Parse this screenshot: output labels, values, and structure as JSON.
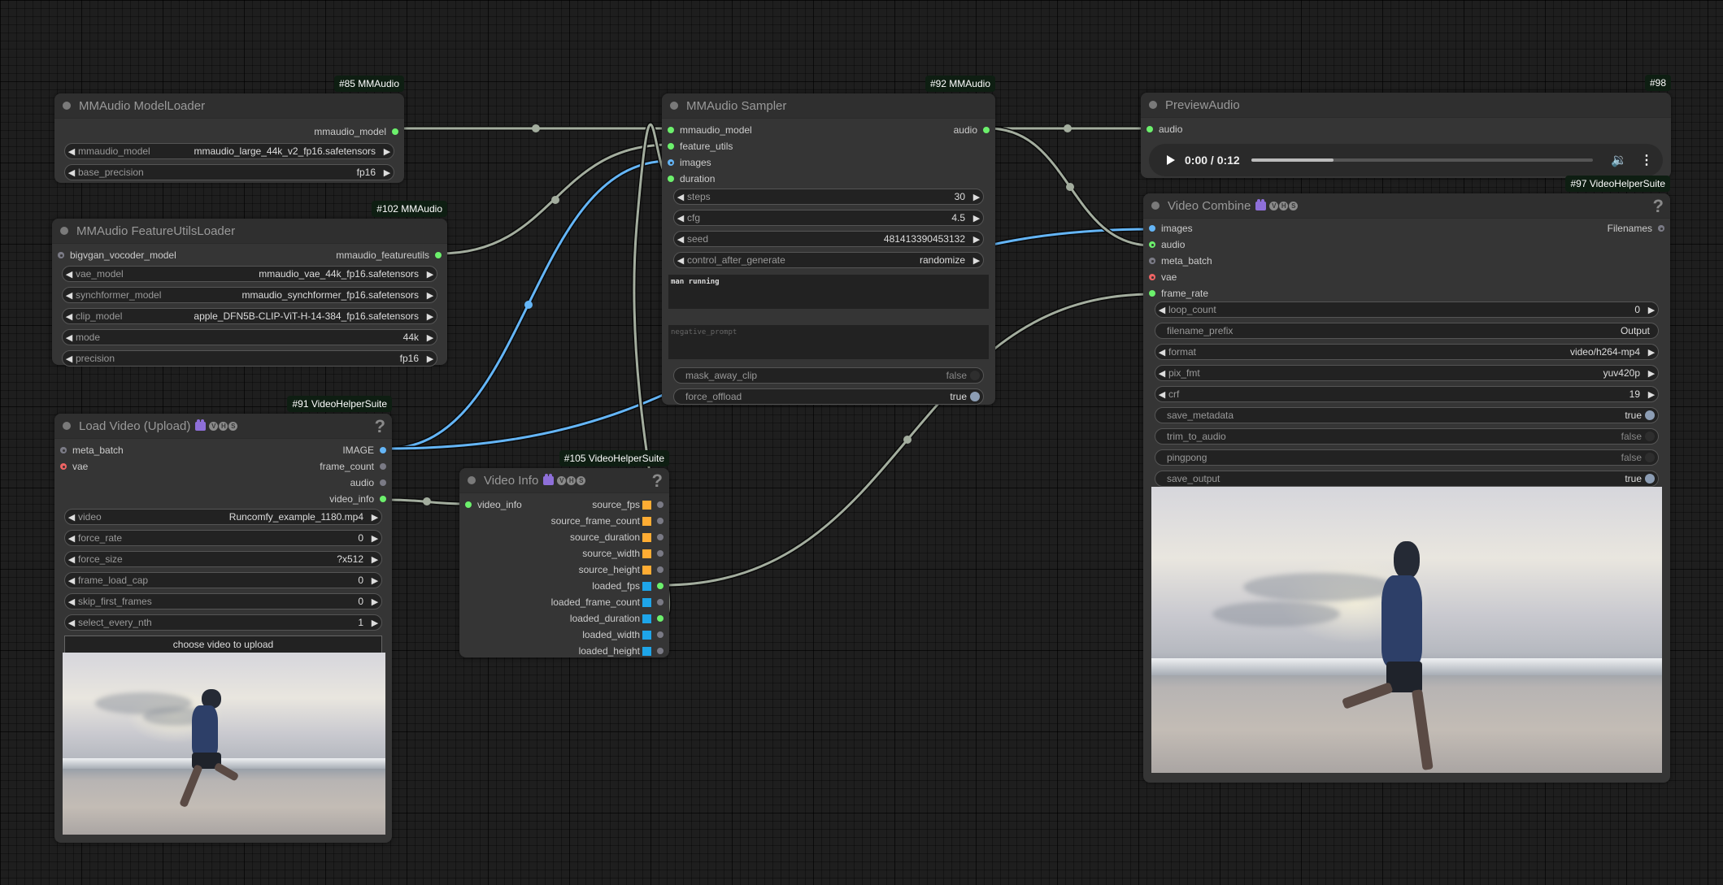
{
  "nodes": {
    "model_loader": {
      "badge": "#85 MMAudio",
      "title": "MMAudio ModelLoader",
      "outputs": [
        "mmaudio_model"
      ],
      "widgets": [
        {
          "label": "mmaudio_model",
          "value": "mmaudio_large_44k_v2_fp16.safetensors"
        },
        {
          "label": "base_precision",
          "value": "fp16"
        }
      ]
    },
    "feature_utils_loader": {
      "badge": "#102 MMAudio",
      "title": "MMAudio FeatureUtilsLoader",
      "inputs": [
        "bigvgan_vocoder_model"
      ],
      "outputs": [
        "mmaudio_featureutils"
      ],
      "widgets": [
        {
          "label": "vae_model",
          "value": "mmaudio_vae_44k_fp16.safetensors"
        },
        {
          "label": "synchformer_model",
          "value": "mmaudio_synchformer_fp16.safetensors"
        },
        {
          "label": "clip_model",
          "value": "apple_DFN5B-CLIP-ViT-H-14-384_fp16.safetensors"
        },
        {
          "label": "mode",
          "value": "44k"
        },
        {
          "label": "precision",
          "value": "fp16"
        }
      ]
    },
    "load_video": {
      "badge": "#91 VideoHelperSuite",
      "title": "Load Video (Upload)",
      "help": "?",
      "vhs": [
        "V",
        "H",
        "S"
      ],
      "inputs": [
        "meta_batch",
        "vae"
      ],
      "outputs": [
        "IMAGE",
        "frame_count",
        "audio",
        "video_info"
      ],
      "widgets": [
        {
          "label": "video",
          "value": "Runcomfy_example_1180.mp4"
        },
        {
          "label": "force_rate",
          "value": "0"
        },
        {
          "label": "force_size",
          "value": "?x512"
        },
        {
          "label": "frame_load_cap",
          "value": "0"
        },
        {
          "label": "skip_first_frames",
          "value": "0"
        },
        {
          "label": "select_every_nth",
          "value": "1"
        }
      ],
      "upload_button": "choose video to upload"
    },
    "sampler": {
      "badge": "#92 MMAudio",
      "title": "MMAudio Sampler",
      "inputs": [
        "mmaudio_model",
        "feature_utils",
        "images",
        "duration"
      ],
      "outputs": [
        "audio"
      ],
      "widgets": [
        {
          "label": "steps",
          "value": "30"
        },
        {
          "label": "cfg",
          "value": "4.5"
        },
        {
          "label": "seed",
          "value": "481413390453132"
        },
        {
          "label": "control_after_generate",
          "value": "randomize"
        }
      ],
      "prompt": "man running",
      "negative_prompt_placeholder": "negative_prompt",
      "toggles": [
        {
          "label": "mask_away_clip",
          "value": "false",
          "on": false
        },
        {
          "label": "force_offload",
          "value": "true",
          "on": true
        }
      ]
    },
    "video_info": {
      "badge": "#105 VideoHelperSuite",
      "title": "Video Info",
      "help": "?",
      "vhs": [
        "V",
        "H",
        "S"
      ],
      "inputs": [
        "video_info"
      ],
      "outputs": [
        {
          "label": "source_fps",
          "kind": "source"
        },
        {
          "label": "source_frame_count",
          "kind": "source"
        },
        {
          "label": "source_duration",
          "kind": "source"
        },
        {
          "label": "source_width",
          "kind": "source"
        },
        {
          "label": "source_height",
          "kind": "source"
        },
        {
          "label": "loaded_fps",
          "kind": "loaded"
        },
        {
          "label": "loaded_frame_count",
          "kind": "loaded"
        },
        {
          "label": "loaded_duration",
          "kind": "loaded"
        },
        {
          "label": "loaded_width",
          "kind": "loaded"
        },
        {
          "label": "loaded_height",
          "kind": "loaded"
        }
      ]
    },
    "preview_audio": {
      "badge": "#98",
      "title": "PreviewAudio",
      "inputs": [
        "audio"
      ],
      "player": {
        "time": "0:00 / 0:12",
        "progress": 0.24
      }
    },
    "video_combine": {
      "badge": "#97 VideoHelperSuite",
      "title": "Video Combine",
      "help": "?",
      "vhs": [
        "V",
        "H",
        "S"
      ],
      "inputs": [
        "images",
        "audio",
        "meta_batch",
        "vae",
        "frame_rate"
      ],
      "outputs": [
        "Filenames"
      ],
      "widgets": [
        {
          "label": "loop_count",
          "value": "0",
          "type": "combo"
        },
        {
          "label": "filename_prefix",
          "value": "Output",
          "type": "text"
        },
        {
          "label": "format",
          "value": "video/h264-mp4",
          "type": "combo"
        },
        {
          "label": "pix_fmt",
          "value": "yuv420p",
          "type": "combo"
        },
        {
          "label": "crf",
          "value": "19",
          "type": "combo"
        },
        {
          "label": "save_metadata",
          "value": "true",
          "type": "toggle",
          "on": true
        },
        {
          "label": "trim_to_audio",
          "value": "false",
          "type": "toggle",
          "on": false
        },
        {
          "label": "pingpong",
          "value": "false",
          "type": "toggle",
          "on": false
        },
        {
          "label": "save_output",
          "value": "true",
          "type": "toggle",
          "on": true
        }
      ]
    }
  },
  "colors": {
    "link_default": "#a3ad9e",
    "link_image": "#64b5f6",
    "slot_green": "#6cf06c",
    "slot_blue": "#64b5f6",
    "slot_red": "#f06464",
    "badge_bg": "#0e1e12"
  },
  "arrows": {
    "left": "◀",
    "right": "▶"
  }
}
